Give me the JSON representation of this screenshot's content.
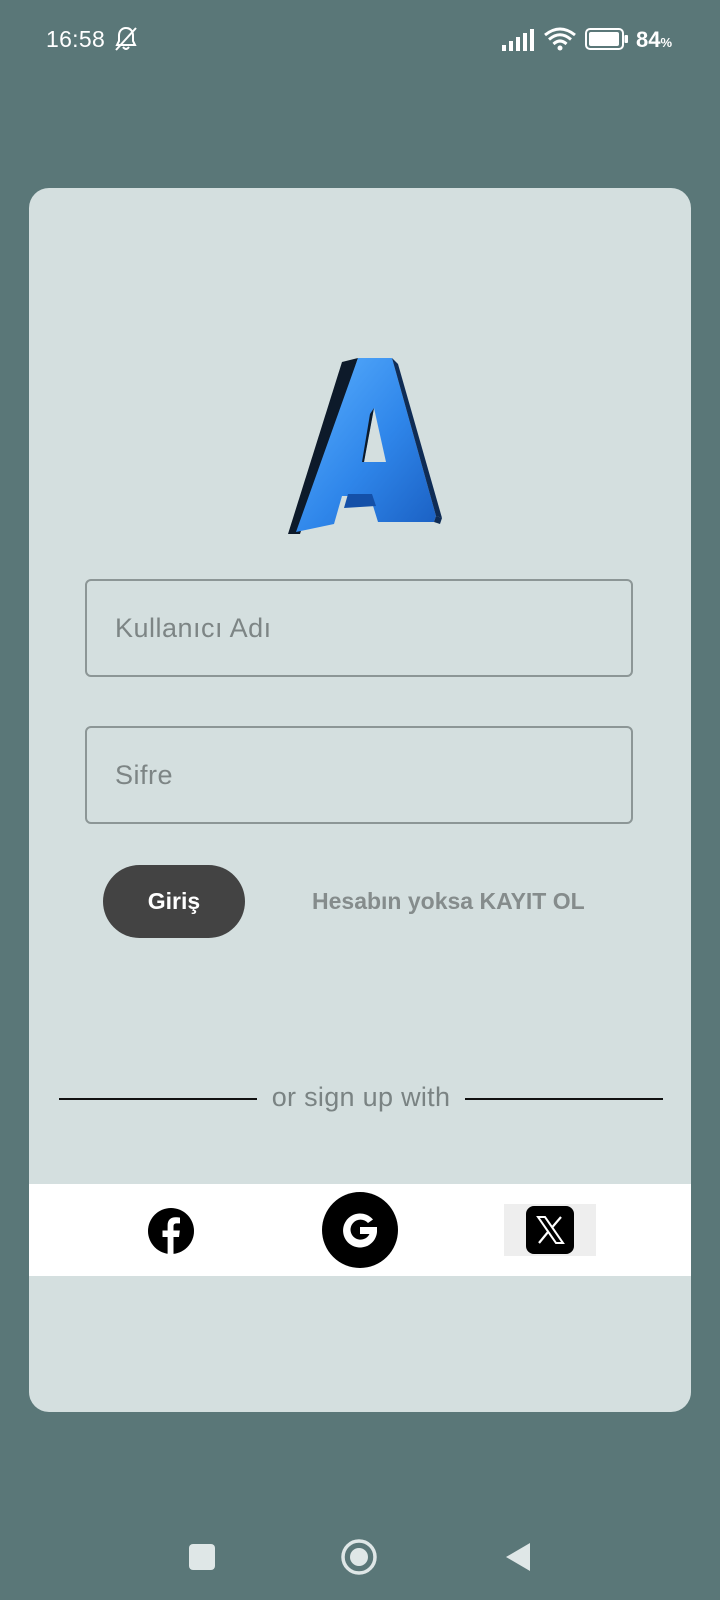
{
  "status_bar": {
    "time": "16:58",
    "battery_level": "84",
    "battery_unit": "%",
    "icons": [
      "bell-off-icon",
      "signal-icon",
      "wifi-icon",
      "battery-icon"
    ]
  },
  "login": {
    "logo": "letter-a-3d-logo",
    "username_placeholder": "Kullanıcı Adı",
    "password_placeholder": "Sifre",
    "login_label": "Giriş",
    "register_label": "Hesabın yoksa KAYIT OL"
  },
  "social": {
    "divider_text": "or sign up with",
    "providers": [
      "facebook-icon",
      "google-icon",
      "x-icon"
    ]
  },
  "nav_bar": {
    "buttons": [
      "recents-icon",
      "home-icon",
      "back-icon"
    ]
  },
  "colors": {
    "background": "#5a7778",
    "card": "#d4dfdf",
    "button": "#434343",
    "logo_blue": "#2f86ea"
  }
}
